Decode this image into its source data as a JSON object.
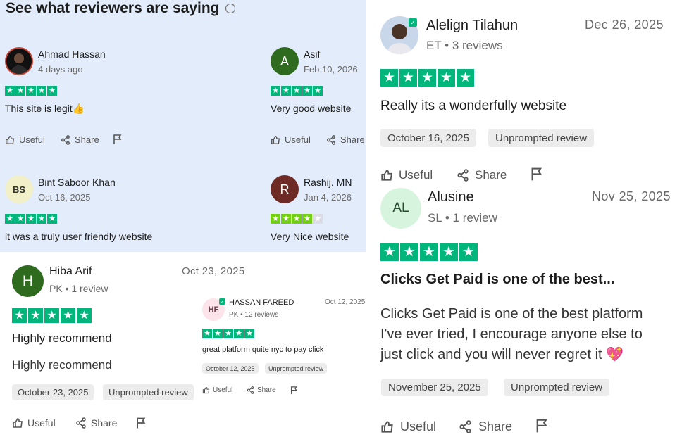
{
  "colors": {
    "panel_bg": "#e3ecfa",
    "star_green": "#00b67a",
    "star_light_green": "#73cf11"
  },
  "panel": {
    "title": "See what reviewers are saying",
    "reviews": [
      {
        "name": "Ahmad Hassan",
        "date": "4 days ago",
        "text": "This site is legit",
        "emoji": "👍",
        "rating": 5,
        "useful": "Useful",
        "share": "Share"
      },
      {
        "name": "Asif",
        "initial": "A",
        "date": "Feb 10, 2026",
        "text": "Very good website",
        "rating": 5,
        "useful": "Useful",
        "share": "Share"
      },
      {
        "name": "Bint Saboor Khan",
        "initial": "BS",
        "date": "Oct 16, 2025",
        "text": "it was a truly user friendly website",
        "rating": 5
      },
      {
        "name": "Rashij. MN",
        "initial": "R",
        "date": "Jan 4, 2026",
        "text": "Very Nice website",
        "rating": 4
      }
    ]
  },
  "hiba": {
    "initial": "H",
    "name": "Hiba Arif",
    "meta": "PK • 1 review",
    "date": "Oct 23, 2025",
    "rating": 5,
    "title": "Highly recommend",
    "body": "Highly recommend",
    "tag_date": "October 23, 2025",
    "tag_type": "Unprompted review",
    "useful": "Useful",
    "share": "Share"
  },
  "hassan": {
    "initial": "HF",
    "name": "HASSAN FAREED",
    "meta": "PK • 12 reviews",
    "date": "Oct 12, 2025",
    "rating": 5,
    "text": "great platform quite nyc to pay click",
    "tag_date": "October 12, 2025",
    "tag_type": "Unprompted review",
    "useful": "Useful",
    "share": "Share"
  },
  "alelign": {
    "name": "Alelign Tilahun",
    "meta": "ET • 3 reviews",
    "date": "Dec 26, 2025",
    "rating": 5,
    "title": "Really its a wonderfully website",
    "tag_date": "October 16, 2025",
    "tag_type": "Unprompted review",
    "useful": "Useful",
    "share": "Share"
  },
  "alusine": {
    "initial": "AL",
    "name": "Alusine",
    "meta": "SL • 1 review",
    "date": "Nov 25, 2025",
    "rating": 5,
    "title": "Clicks Get Paid is one of the best...",
    "body_lines": [
      "Clicks Get Paid is one of the best platform",
      "I've ever tried, I encourage anyone else to",
      "just click and you will never regret it"
    ],
    "emoji": "💖",
    "tag_date": "November 25, 2025",
    "tag_type": "Unprompted review",
    "useful": "Useful",
    "share": "Share"
  }
}
